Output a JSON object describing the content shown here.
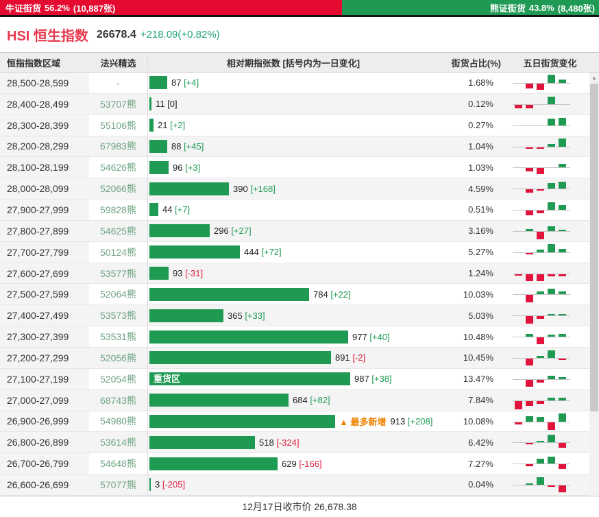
{
  "top_bar": {
    "bull": {
      "label": "牛证街货",
      "percent": "56.2%",
      "count": "(10,887张)",
      "width_pct": 56.2,
      "color": "#e50a30"
    },
    "bear": {
      "label": "熊证街货",
      "percent": "43.8%",
      "count": "(8,480张)",
      "color": "#1f9a55"
    }
  },
  "index_header": {
    "name": "HSI 恒生指数",
    "price": "26678.4",
    "change": "+218.09(+0.82%)"
  },
  "table": {
    "columns": [
      "恒指指数区域",
      "法兴精选",
      "相对期指张数 [括号内为一日变化]",
      "街货占比(%)",
      "五日街货变化"
    ],
    "max_value": 987,
    "bar_color": "#1e9a53",
    "up_color": "#1e9a53",
    "down_color": "#e0143c",
    "rows": [
      {
        "range": "28,500-28,599",
        "pick": "-",
        "value": 87,
        "change": "[+4]",
        "change_type": "pos",
        "pct": "1.68%",
        "five_day": [
          0,
          -0.55,
          -0.7,
          0.95,
          0.35
        ]
      },
      {
        "range": "28,400-28,499",
        "pick": "53707熊",
        "value": 11,
        "change": "[0]",
        "change_type": "zero",
        "pct": "0.12%",
        "five_day": [
          -0.35,
          -0.4,
          0,
          0.85,
          0
        ]
      },
      {
        "range": "28,300-28,399",
        "pick": "55106熊",
        "value": 21,
        "change": "[+2]",
        "change_type": "pos",
        "pct": "0.27%",
        "five_day": [
          0,
          0,
          0,
          0.8,
          0.85
        ]
      },
      {
        "range": "28,200-28,299",
        "pick": "67983熊",
        "value": 88,
        "change": "[+45]",
        "change_type": "pos",
        "pct": "1.04%",
        "five_day": [
          0,
          -0.12,
          -0.12,
          0.3,
          0.95
        ]
      },
      {
        "range": "28,100-28,199",
        "pick": "54626熊",
        "value": 96,
        "change": "[+3]",
        "change_type": "pos",
        "pct": "1.03%",
        "five_day": [
          0,
          -0.4,
          -0.7,
          0,
          0.35
        ]
      },
      {
        "range": "28,000-28,099",
        "pick": "52066熊",
        "value": 390,
        "change": "[+168]",
        "change_type": "pos",
        "pct": "4.59%",
        "five_day": [
          0,
          -0.4,
          -0.18,
          0.6,
          0.8
        ]
      },
      {
        "range": "27,900-27,999",
        "pick": "59828熊",
        "value": 44,
        "change": "[+7]",
        "change_type": "pos",
        "pct": "0.51%",
        "five_day": [
          0,
          -0.5,
          -0.3,
          0.85,
          0.55
        ]
      },
      {
        "range": "27,800-27,899",
        "pick": "54625熊",
        "value": 296,
        "change": "[+27]",
        "change_type": "pos",
        "pct": "3.16%",
        "five_day": [
          0,
          0.22,
          -0.85,
          0.55,
          0.15
        ]
      },
      {
        "range": "27,700-27,799",
        "pick": "50124熊",
        "value": 444,
        "change": "[+72]",
        "change_type": "pos",
        "pct": "5.27%",
        "five_day": [
          0,
          -0.15,
          0.3,
          0.9,
          0.35
        ]
      },
      {
        "range": "27,600-27,699",
        "pick": "53577熊",
        "value": 93,
        "change": "[-31]",
        "change_type": "neg",
        "pct": "1.24%",
        "five_day": [
          -0.15,
          -0.8,
          -0.8,
          -0.2,
          -0.2
        ]
      },
      {
        "range": "27,500-27,599",
        "pick": "52064熊",
        "value": 784,
        "change": "[+22]",
        "change_type": "pos",
        "pct": "10.03%",
        "five_day": [
          0,
          -0.85,
          0.3,
          0.65,
          0.3
        ]
      },
      {
        "range": "27,400-27,499",
        "pick": "53573熊",
        "value": 365,
        "change": "[+33]",
        "change_type": "pos",
        "pct": "5.03%",
        "five_day": [
          0,
          -0.85,
          -0.3,
          0.15,
          0.15
        ]
      },
      {
        "range": "27,300-27,399",
        "pick": "53531熊",
        "value": 977,
        "change": "[+40]",
        "change_type": "pos",
        "pct": "10.48%",
        "five_day": [
          0,
          0.3,
          -0.8,
          0.22,
          0.28
        ]
      },
      {
        "range": "27,200-27,299",
        "pick": "52056熊",
        "value": 891,
        "change": "[-2]",
        "change_type": "neg",
        "pct": "10.45%",
        "five_day": [
          0,
          -0.8,
          0.25,
          0.85,
          -0.1
        ]
      },
      {
        "range": "27,100-27,199",
        "pick": "52054熊",
        "value": 987,
        "change": "[+38]",
        "change_type": "pos",
        "pct": "13.47%",
        "tag": "重货区",
        "five_day": [
          0,
          -0.8,
          -0.3,
          0.35,
          0.2
        ]
      },
      {
        "range": "27,000-27,099",
        "pick": "68743熊",
        "value": 684,
        "change": "[+82]",
        "change_type": "pos",
        "pct": "7.84%",
        "five_day": [
          -0.9,
          -0.5,
          -0.28,
          0.3,
          0.3
        ]
      },
      {
        "range": "26,900-26,999",
        "pick": "54980熊",
        "value": 913,
        "change": "[+208]",
        "change_type": "pos",
        "pct": "10.08%",
        "note": "▲ 最多新增",
        "five_day": [
          -0.25,
          0.6,
          0.5,
          -0.85,
          0.95
        ]
      },
      {
        "range": "26,800-26,899",
        "pick": "53614熊",
        "value": 518,
        "change": "[-324]",
        "change_type": "neg",
        "pct": "6.42%",
        "five_day": [
          0,
          -0.1,
          0.15,
          0.85,
          -0.5
        ]
      },
      {
        "range": "26,700-26,799",
        "pick": "54648熊",
        "value": 629,
        "change": "[-166]",
        "change_type": "neg",
        "pct": "7.27%",
        "five_day": [
          0,
          -0.25,
          0.55,
          0.8,
          -0.5
        ]
      },
      {
        "range": "26,600-26,699",
        "pick": "57077熊",
        "value": 3,
        "change": "[-205]",
        "change_type": "neg",
        "pct": "0.04%",
        "five_day": [
          0,
          0.12,
          0.85,
          -0.1,
          -0.8
        ]
      }
    ]
  },
  "scrollbar": {
    "up_arrow": "▲"
  },
  "footer": {
    "text": "12月17日收市价 26,678.38"
  }
}
